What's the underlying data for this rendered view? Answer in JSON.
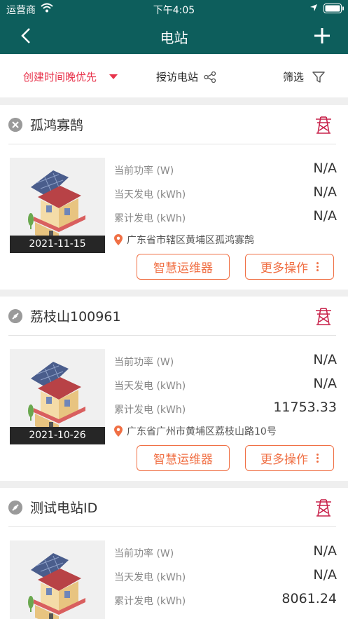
{
  "status_bar": {
    "carrier": "运营商",
    "time": "下午4:05"
  },
  "nav": {
    "title": "电站"
  },
  "filter_bar": {
    "sort_label": "创建时间晚优先",
    "visit_label": "授访电站",
    "filter_label": "筛选"
  },
  "stations": [
    {
      "name": "孤鸿寡鹄",
      "status": "offline",
      "date": "2021-11-15",
      "rows": [
        {
          "label": "当前功率 (W)",
          "value": "N/A"
        },
        {
          "label": "当天发电 (kWh)",
          "value": "N/A"
        },
        {
          "label": "累计发电 (kWh)",
          "value": "N/A"
        }
      ],
      "address": "广东省市辖区黄埔区孤鸿寡鹄",
      "smart_button": "智慧运维器",
      "more_button": "更多操作"
    },
    {
      "name": "荔枝山100961",
      "status": "disconnected",
      "date": "2021-10-26",
      "rows": [
        {
          "label": "当前功率 (W)",
          "value": "N/A"
        },
        {
          "label": "当天发电 (kWh)",
          "value": "N/A"
        },
        {
          "label": "累计发电 (kWh)",
          "value": "11753.33"
        }
      ],
      "address": "广东省广州市黄埔区荔枝山路10号",
      "smart_button": "智慧运维器",
      "more_button": "更多操作"
    },
    {
      "name": "测试电站ID",
      "status": "disconnected",
      "rows": [
        {
          "label": "当前功率 (W)",
          "value": "N/A"
        },
        {
          "label": "当天发电 (kWh)",
          "value": "N/A"
        },
        {
          "label": "累计发电 (kWh)",
          "value": "8061.24"
        }
      ]
    }
  ],
  "colors": {
    "header": "#0d5e5c",
    "sort_accent": "#e8344c",
    "button_accent": "#f07045",
    "tower": "#c8234b"
  }
}
